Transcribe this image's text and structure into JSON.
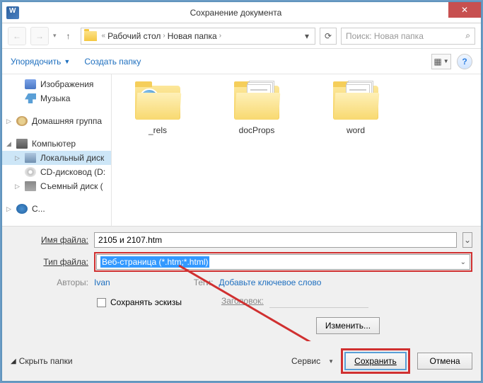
{
  "title": "Сохранение документа",
  "nav": {
    "back": "←",
    "forward": "→",
    "up": "↑",
    "refresh": "⟳"
  },
  "breadcrumb": {
    "prefix": "«",
    "part1": "Рабочий стол",
    "part2": "Новая папка",
    "dropdown": "▾"
  },
  "search": {
    "placeholder": "Поиск: Новая папка",
    "icon": "🔍"
  },
  "toolbar": {
    "organize": "Упорядочить",
    "newfolder": "Создать папку"
  },
  "sidebar": {
    "pictures": "Изображения",
    "music": "Музыка",
    "homegroup": "Домашняя группа",
    "computer": "Компьютер",
    "localdisk": "Локальный диск",
    "cddrive": "CD-дисковод (D:",
    "removable": "Съемный диск (",
    "network_cut": "С..."
  },
  "folders": {
    "rels": "_rels",
    "docprops": "docProps",
    "word": "word"
  },
  "form": {
    "filename_label": "Имя файла:",
    "filename_value": "2105 и 2107.htm",
    "filetype_label": "Тип файла:",
    "filetype_value": "Веб-страница (*.htm;*.html)"
  },
  "meta": {
    "authors_label": "Авторы:",
    "authors_value": "Ivan",
    "tags_label": "Теги:",
    "tags_value": "Добавьте ключевое слово",
    "thumbs_label": "Сохранять эскизы",
    "title_label": "Заголовок:",
    "change_btn": "Изменить..."
  },
  "footer": {
    "hide": "Скрыть папки",
    "service": "Сервис",
    "save": "Сохранить",
    "cancel": "Отмена"
  }
}
